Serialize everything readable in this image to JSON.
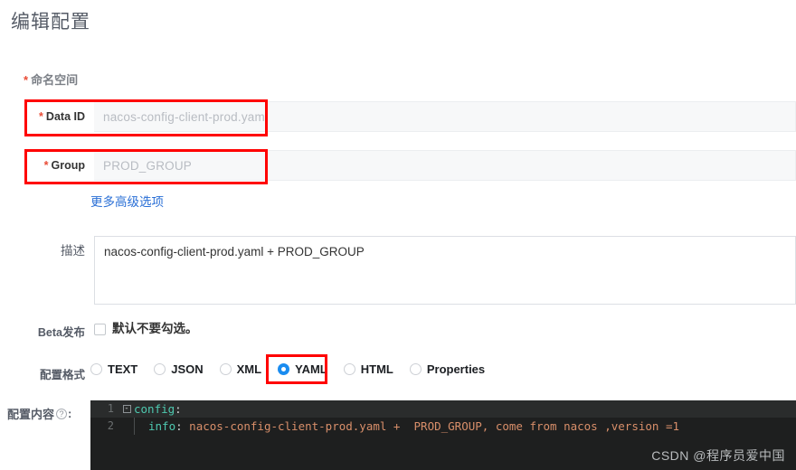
{
  "page": {
    "title": "编辑配置"
  },
  "namespace": {
    "required_mark": "*",
    "label": "命名空间"
  },
  "fields": {
    "data_id": {
      "required_mark": "*",
      "label": "Data ID",
      "placeholder": "nacos-config-client-prod.yaml",
      "value": ""
    },
    "group": {
      "required_mark": "*",
      "label": "Group",
      "placeholder": "PROD_GROUP",
      "value": ""
    }
  },
  "advanced_link": "更多高级选项",
  "description": {
    "label": "描述",
    "value": "nacos-config-client-prod.yaml +  PROD_GROUP"
  },
  "beta": {
    "label": "Beta发布",
    "checkbox_checked": false,
    "hint": "默认不要勾选。"
  },
  "config_format": {
    "label": "配置格式",
    "selected": "YAML",
    "options": [
      {
        "label": "TEXT",
        "selected": false
      },
      {
        "label": "JSON",
        "selected": false
      },
      {
        "label": "XML",
        "selected": false
      },
      {
        "label": "YAML",
        "selected": true
      },
      {
        "label": "HTML",
        "selected": false
      },
      {
        "label": "Properties",
        "selected": false
      }
    ]
  },
  "config_content": {
    "label": "配置内容",
    "help_icon": "question-mark-icon",
    "colon": ":",
    "lines": [
      {
        "number": "1",
        "fold": "-",
        "key": "config",
        "punct": ":",
        "value": ""
      },
      {
        "number": "2",
        "fold": "",
        "key": "info",
        "punct": ":",
        "value": " nacos-config-client-prod.yaml +  PROD_GROUP, come from nacos ,version =1"
      }
    ]
  },
  "annotations": {
    "accent_color": "#ff0000",
    "boxes": [
      "data-id-field",
      "group-field",
      "yaml-radio"
    ]
  },
  "watermark": "CSDN @程序员爱中国"
}
